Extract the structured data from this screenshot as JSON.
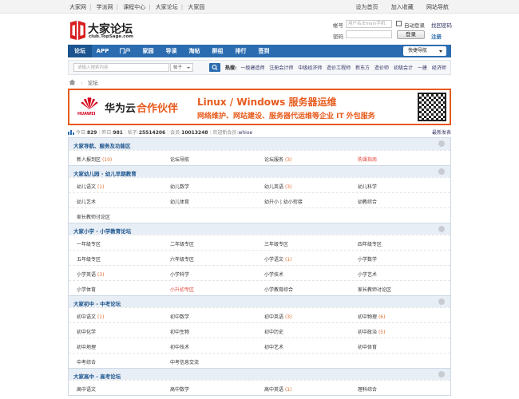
{
  "topbar": {
    "left_links": [
      "大家网",
      "学派网",
      "课程中心",
      "大家论坛",
      "大家园"
    ],
    "right_links": [
      "设为首页",
      "加入收藏",
      "网站导航"
    ]
  },
  "logo": {
    "title": "大家论坛",
    "domain": "club.TopSage.com"
  },
  "login": {
    "account_label": "帐号",
    "account_placeholder": "用户名/Email/手机",
    "remember_label": "自动登录",
    "forgot_label": "找回密码",
    "password_label": "密码",
    "login_button": "登录",
    "register_label": "注册"
  },
  "nav": {
    "items": [
      "论坛",
      "APP",
      "门户",
      "家园",
      "导读",
      "淘帖",
      "群组",
      "排行",
      "签到"
    ],
    "quick_label": "快捷导航"
  },
  "search": {
    "placeholder": "请输入搜索内容",
    "scope": "帖子",
    "hot_label": "热搜:",
    "hot_terms": [
      "一级建造师",
      "注册会计师",
      "中级经济师",
      "造价工程师",
      "新东方",
      "造价师",
      "初级会计",
      "一建",
      "经济师"
    ]
  },
  "breadcrumb": "论坛",
  "banner": {
    "brand": "华为云",
    "brand_en": "HUAWEI",
    "partner": "合作伙伴",
    "headline": "Linux / Windows 服务器运维",
    "subline": "网络维护、网站建设、服务器代运维等企业 IT 外包服务",
    "colors": {
      "accent": "#e85a1c",
      "huawei_red": "#d6001c"
    }
  },
  "stats": {
    "today_label": "今日:",
    "today": "829",
    "yesterday_label": "昨日:",
    "yesterday": "981",
    "posts_label": "帖子:",
    "posts": "25514206",
    "members_label": "会员:",
    "members": "10013248",
    "welcome_label": "欢迎新会员:",
    "newest": "whioe",
    "latest_label": "最新发表"
  },
  "categories": [
    {
      "name": "大家导航、服务及功能区",
      "rows": [
        [
          {
            "n": "新人报到区",
            "c": "(10)"
          },
          {
            "n": "论坛导航"
          },
          {
            "n": "论坛服务",
            "c": "(3)"
          },
          {
            "n": "购课指南",
            "red": true
          }
        ]
      ]
    },
    {
      "name": "大家幼儿园 - 幼儿早期教育",
      "rows": [
        [
          {
            "n": "幼儿语文",
            "c": "(1)"
          },
          {
            "n": "幼儿数学"
          },
          {
            "n": "幼儿英语",
            "c": "(3)"
          },
          {
            "n": "幼儿科学"
          }
        ],
        [
          {
            "n": "幼儿艺术"
          },
          {
            "n": "幼儿体育"
          },
          {
            "n": "幼升小 | 幼小衔接"
          },
          {
            "n": "幼教综合"
          }
        ],
        [
          {
            "n": "家长教师讨论区"
          }
        ]
      ]
    },
    {
      "name": "大家小学 - 小学教育论坛",
      "rows": [
        [
          {
            "n": "一年级专区"
          },
          {
            "n": "二年级专区"
          },
          {
            "n": "三年级专区"
          },
          {
            "n": "四年级专区"
          }
        ],
        [
          {
            "n": "五年级专区"
          },
          {
            "n": "六年级专区"
          },
          {
            "n": "小学语文",
            "c": "(1)"
          },
          {
            "n": "小学数学"
          }
        ],
        [
          {
            "n": "小学英语",
            "c": "(3)"
          },
          {
            "n": "小学科学"
          },
          {
            "n": "小学技术"
          },
          {
            "n": "小学艺术"
          }
        ],
        [
          {
            "n": "小学体育"
          },
          {
            "n": "小升初专区",
            "red": true
          },
          {
            "n": "小学教育综合"
          },
          {
            "n": "家长教师讨论区"
          }
        ]
      ]
    },
    {
      "name": "大家初中 - 中考论坛",
      "rows": [
        [
          {
            "n": "初中语文",
            "c": "(1)"
          },
          {
            "n": "初中数学"
          },
          {
            "n": "初中英语",
            "c": "(3)"
          },
          {
            "n": "初中物理",
            "c": "(6)"
          }
        ],
        [
          {
            "n": "初中化学"
          },
          {
            "n": "初中生物"
          },
          {
            "n": "初中历史"
          },
          {
            "n": "初中政治",
            "c": "(5)"
          }
        ],
        [
          {
            "n": "初中地理"
          },
          {
            "n": "初中技术"
          },
          {
            "n": "初中艺术"
          },
          {
            "n": "初中体育"
          }
        ],
        [
          {
            "n": "中考综合"
          },
          {
            "n": "中考信息交流"
          }
        ]
      ]
    },
    {
      "name": "大家高中 - 高考论坛",
      "rows": [
        [
          {
            "n": "高中语文"
          },
          {
            "n": "高中数学"
          },
          {
            "n": "高中英语",
            "c": "(1)"
          },
          {
            "n": "理科综合"
          }
        ]
      ]
    }
  ]
}
